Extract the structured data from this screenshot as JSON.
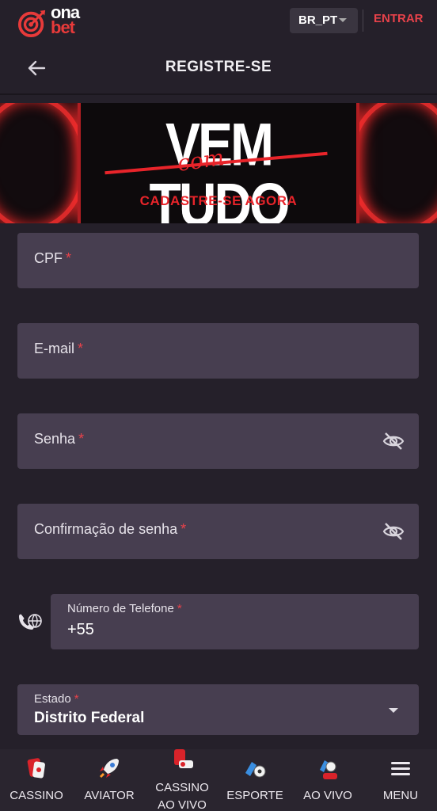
{
  "header": {
    "logo_word_top": "ona",
    "logo_word_bottom": "bet",
    "language": "BR_PT",
    "login_label": "ENTRAR"
  },
  "page": {
    "title": "REGISTRE-SE"
  },
  "banner": {
    "headline": "VEM TUDO",
    "script_word": "com",
    "subheadline": "CADASTRE-SE AGORA"
  },
  "form": {
    "cpf": {
      "label": "CPF",
      "required": "*"
    },
    "email": {
      "label": "E-mail",
      "required": "*"
    },
    "password": {
      "label": "Senha",
      "required": "*"
    },
    "password_confirm": {
      "label": "Confirmação de senha",
      "required": "*"
    },
    "phone": {
      "label": "Número de Telefone",
      "required": "*",
      "value": "+55"
    },
    "state": {
      "label": "Estado",
      "required": "*",
      "value": "Distrito Federal"
    }
  },
  "nav": {
    "items": [
      {
        "label": "CASSINO",
        "icon": "cassino-icon"
      },
      {
        "label": "AVIATOR",
        "icon": "rocket-icon"
      },
      {
        "label_line1": "CASSINO",
        "label_line2": "AO VIVO",
        "icon": "live-casino-icon"
      },
      {
        "label": "ESPORTE",
        "icon": "sport-icon"
      },
      {
        "label": "AO VIVO",
        "icon": "live-sport-icon"
      },
      {
        "label": "MENU",
        "icon": "hamburger-icon"
      }
    ]
  },
  "colors": {
    "background": "#25202a",
    "field": "#473e50",
    "accent": "#e8424a",
    "nav": "#2a252f"
  }
}
